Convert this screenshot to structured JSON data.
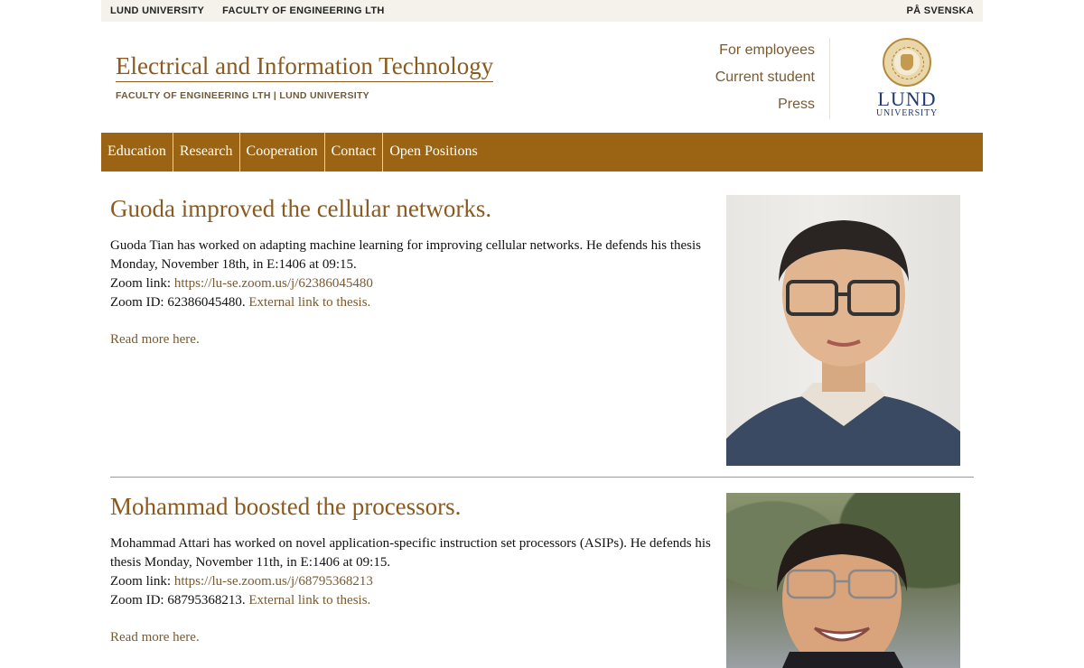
{
  "topbar": {
    "university": "LUND UNIVERSITY",
    "faculty": "FACULTY OF ENGINEERING LTH",
    "language": "PÅ SVENSKA"
  },
  "header": {
    "title": "Electrical and Information Technology",
    "subtitle": "FACULTY OF ENGINEERING LTH | LUND UNIVERSITY",
    "quick_links": [
      "For employees",
      "Current student",
      "Press"
    ],
    "logo_word": "LUND",
    "logo_sub": "UNIVERSITY"
  },
  "nav": {
    "items": [
      "Education",
      "Research",
      "Cooperation",
      "Contact",
      "Open Positions"
    ]
  },
  "articles": [
    {
      "headline": "Guoda improved the cellular networks.",
      "text": "Guoda Tian has worked on adapting machine learning for improving cellular networks. He defends his thesis Monday, November 18th, in E:1406 at 09:15.",
      "zoom_label": "Zoom link: ",
      "zoom_link": "https://lu-se.zoom.us/j/62386045480",
      "zoom_id_text": "Zoom ID: 62386045480. ",
      "thesis_link": "External link to thesis.",
      "read_more": "Read more here.",
      "photo_icon": "portrait-photo"
    },
    {
      "headline": "Mohammad boosted the processors.",
      "text": "Mohammad Attari has worked on novel application-specific instruction set processors (ASIPs). He defends his thesis Monday, November 11th, in E:1406 at 09:15.",
      "zoom_label": "Zoom link: ",
      "zoom_link": "https://lu-se.zoom.us/j/68795368213",
      "zoom_id_text": "Zoom ID: 68795368213. ",
      "thesis_link": "External link to thesis.",
      "read_more": "Read more here.",
      "photo_icon": "portrait-photo"
    }
  ],
  "colors": {
    "accent": "#8b5a1e",
    "nav_bg": "#9a6414",
    "topbar_bg": "#f5f2ec",
    "logo_blue": "#1f3a6e"
  }
}
